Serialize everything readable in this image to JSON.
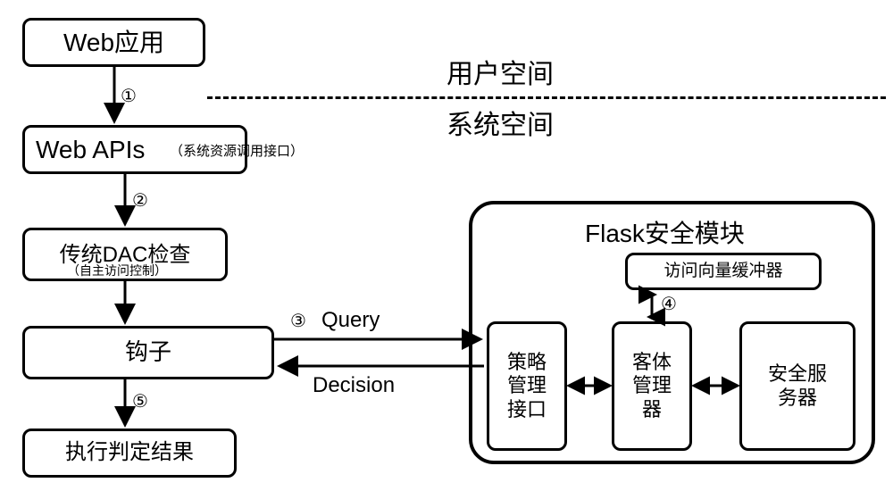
{
  "labels": {
    "userspace": "用户空间",
    "systemspace": "系统空间"
  },
  "boxes": {
    "webapp": "Web应用",
    "webapis": "Web APIs",
    "webapis_sub": "（系统资源调用接口）",
    "dac": "传统DAC检查",
    "dac_sub": "（自主访问控制）",
    "hook": "钩子",
    "result": "执行判定结果",
    "flask_title": "Flask安全模块",
    "avc": "访问向量缓冲器",
    "policy": "策略\n管理\n接口",
    "object_mgr": "客体\n管理\n器",
    "sec_server": "安全服\n务器"
  },
  "edges": {
    "query": "Query",
    "decision": "Decision"
  },
  "steps": {
    "s1": "①",
    "s2": "②",
    "s3": "③",
    "s4": "④",
    "s5": "⑤"
  }
}
